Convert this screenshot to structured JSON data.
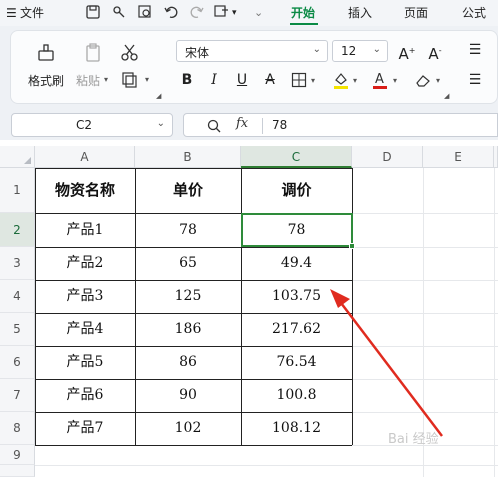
{
  "menubar": {
    "file_label": "文件",
    "tabs": [
      "开始",
      "插入",
      "页面",
      "公式"
    ]
  },
  "ribbon": {
    "format_painter_label": "格式刷",
    "paste_label": "粘贴",
    "font_name": "宋体",
    "font_size": "12"
  },
  "formula_bar": {
    "cell_ref": "C2",
    "fx_label": "fx",
    "value": "78"
  },
  "sheet": {
    "columns": [
      "A",
      "B",
      "C",
      "D",
      "E"
    ],
    "rows": [
      "1",
      "2",
      "3",
      "4",
      "5",
      "6",
      "7",
      "8",
      "9"
    ],
    "header": [
      "物资名称",
      "单价",
      "调价"
    ],
    "data": [
      [
        "产品1",
        "78",
        "78"
      ],
      [
        "产品2",
        "65",
        "49.4"
      ],
      [
        "产品3",
        "125",
        "103.75"
      ],
      [
        "产品4",
        "186",
        "217.62"
      ],
      [
        "产品5",
        "86",
        "76.54"
      ],
      [
        "产品6",
        "90",
        "100.8"
      ],
      [
        "产品7",
        "102",
        "108.12"
      ]
    ]
  },
  "colors": {
    "accent_green": "#0a8a45",
    "selection_green": "#2e8b3a",
    "arrow_red": "#e02b1f"
  },
  "watermark": "Bai 经验"
}
